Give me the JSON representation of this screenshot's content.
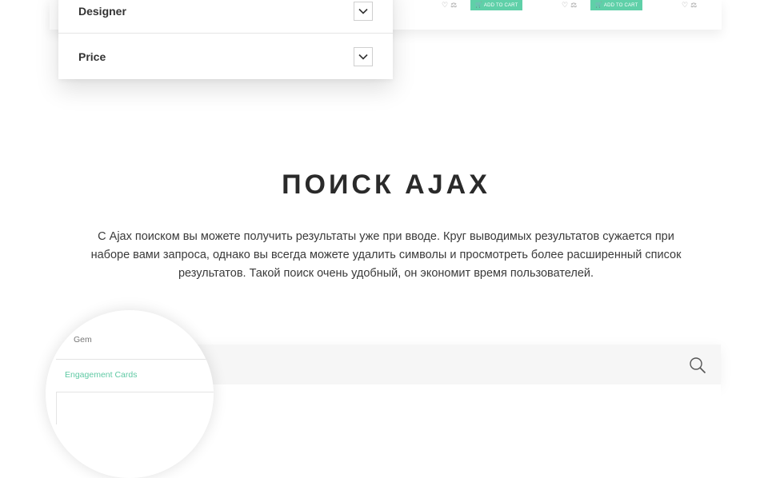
{
  "product_strip": {
    "add_to_cart_label": "ADD TO CART",
    "cart_icon": "cart-icon",
    "wishlist_icon": "heart-icon",
    "compare_icon": "compare-icon"
  },
  "filters": {
    "items": [
      {
        "label": "Designer",
        "icon": "chevron-down-icon"
      },
      {
        "label": "Price",
        "icon": "chevron-down-icon"
      }
    ]
  },
  "section": {
    "title": "ПОИСК AJAX",
    "description": "С Ajax поиском вы можете получить результаты уже при вводе. Круг выводимых результатов сужается при наборе вами запроса, однако вы всегда можете удалить символы и просмотреть более расширенный список результатов. Такой поиск очень удобный, он экономит время пользователей."
  },
  "search": {
    "icon": "search-icon",
    "suggestions": [
      "Gem",
      "Engagement Cards"
    ]
  },
  "colors": {
    "accent": "#5fd0a8",
    "text": "#333333",
    "muted": "#777777"
  }
}
